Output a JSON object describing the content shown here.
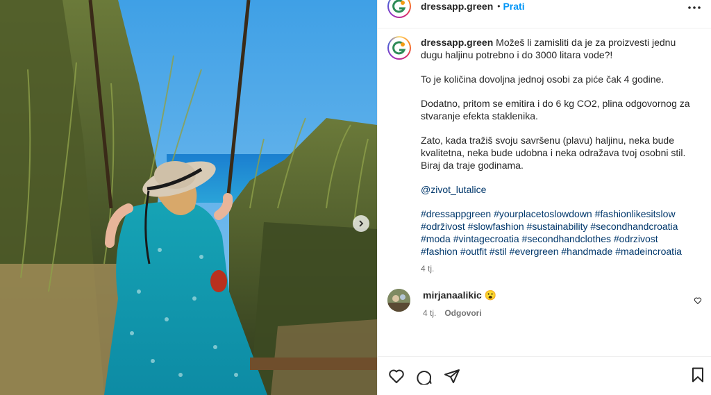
{
  "post": {
    "account": "dressapp.green",
    "separator": "•",
    "follow_label": "Prati"
  },
  "caption": {
    "paragraph1_text": "Možeš li zamisliti da je za proizvesti jednu dugu haljinu potrebno i do 3000 litara vode?!",
    "paragraph2": "To je količina dovoljna jednoj osobi za piće čak 4 godine.",
    "paragraph3": "Dodatno, pritom se emitira i do 6 kg CO2, plina odgovornog za stvaranje efekta staklenika.",
    "paragraph4": "Zato, kada tražiš svoju savršenu (plavu) haljinu, neka bude kvalitetna, neka bude udobna i neka odražava tvoj osobni stil. Biraj da traje godinama.",
    "mention": "@zivot_lutalice",
    "hashtags": [
      "#dressappgreen",
      "#yourplacetoslowdown",
      "#fashionlikesitslow",
      "#održivost",
      "#slowfashion",
      "#sustainability",
      "#secondhandcroatia",
      "#moda",
      "#vintagecroatia",
      "#secondhandclothes",
      "#odrzivost",
      "#fashion",
      "#outfit",
      "#stil",
      "#evergreen",
      "#handmade",
      "#madeincroatia"
    ],
    "time": "4 tj."
  },
  "comment": {
    "user": "mirjanaalikic",
    "text": "😮",
    "time": "4 tj.",
    "reply_label": "Odgovori"
  },
  "colors": {
    "accent": "#0095f6",
    "link": "#00376b",
    "meta": "#737373",
    "logo_green": "#2e8b57",
    "logo_orange": "#f39c12"
  },
  "icons": {
    "more": "more-horizontal-icon",
    "next": "chevron-right-icon",
    "like": "heart-icon",
    "comment": "comment-icon",
    "share": "paper-plane-icon",
    "save": "bookmark-icon"
  }
}
